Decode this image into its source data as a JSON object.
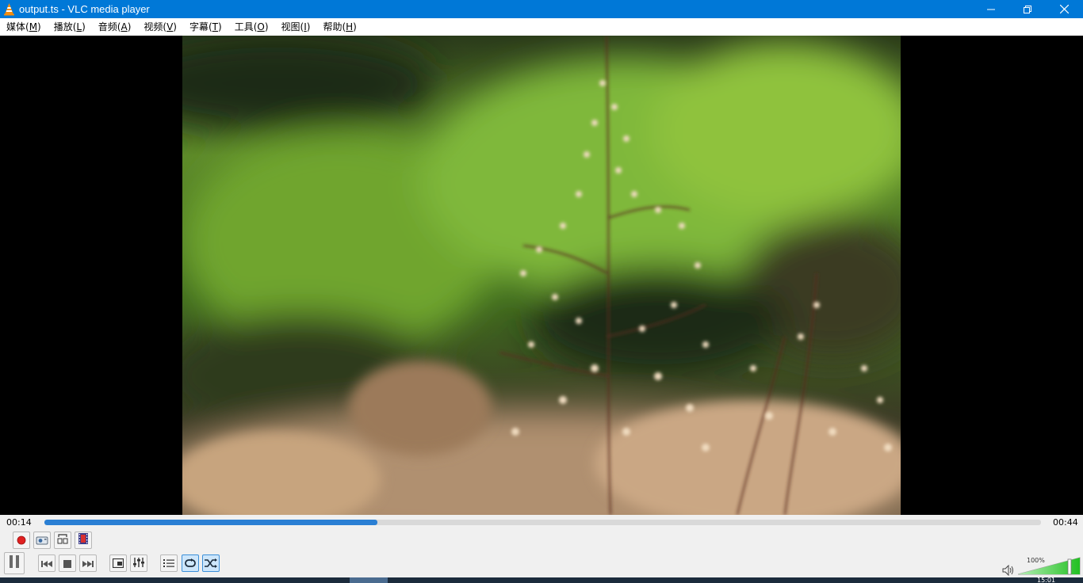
{
  "window": {
    "title": "output.ts - VLC media player",
    "icon": "vlc-cone-icon",
    "controls": [
      "minimize-icon",
      "restore-icon",
      "close-icon"
    ]
  },
  "menu": {
    "items": [
      {
        "label": "媒体(",
        "key": "M",
        "end": ")"
      },
      {
        "label": "播放(",
        "key": "L",
        "end": ")"
      },
      {
        "label": "音频(",
        "key": "A",
        "end": ")"
      },
      {
        "label": "视频(",
        "key": "V",
        "end": ")"
      },
      {
        "label": "字幕(",
        "key": "T",
        "end": ")"
      },
      {
        "label": "工具(",
        "key": "O",
        "end": ")"
      },
      {
        "label": "视图(",
        "key": "I",
        "end": ")"
      },
      {
        "label": "帮助(",
        "key": "H",
        "end": ")"
      }
    ]
  },
  "video": {
    "content": "blurred green shrubs with pale flowering plant stems in foreground"
  },
  "playback": {
    "elapsed": "00:14",
    "total": "00:44",
    "progress": 0.334
  },
  "volume": {
    "label": "100%",
    "level": 1.0
  },
  "colors": {
    "titlebar": "#0078d7",
    "seek_fill": "#2a7fd4",
    "volume_fill": "#33c633",
    "record": "#e02020"
  },
  "taskbar": {
    "clock_partial": "15:01"
  }
}
